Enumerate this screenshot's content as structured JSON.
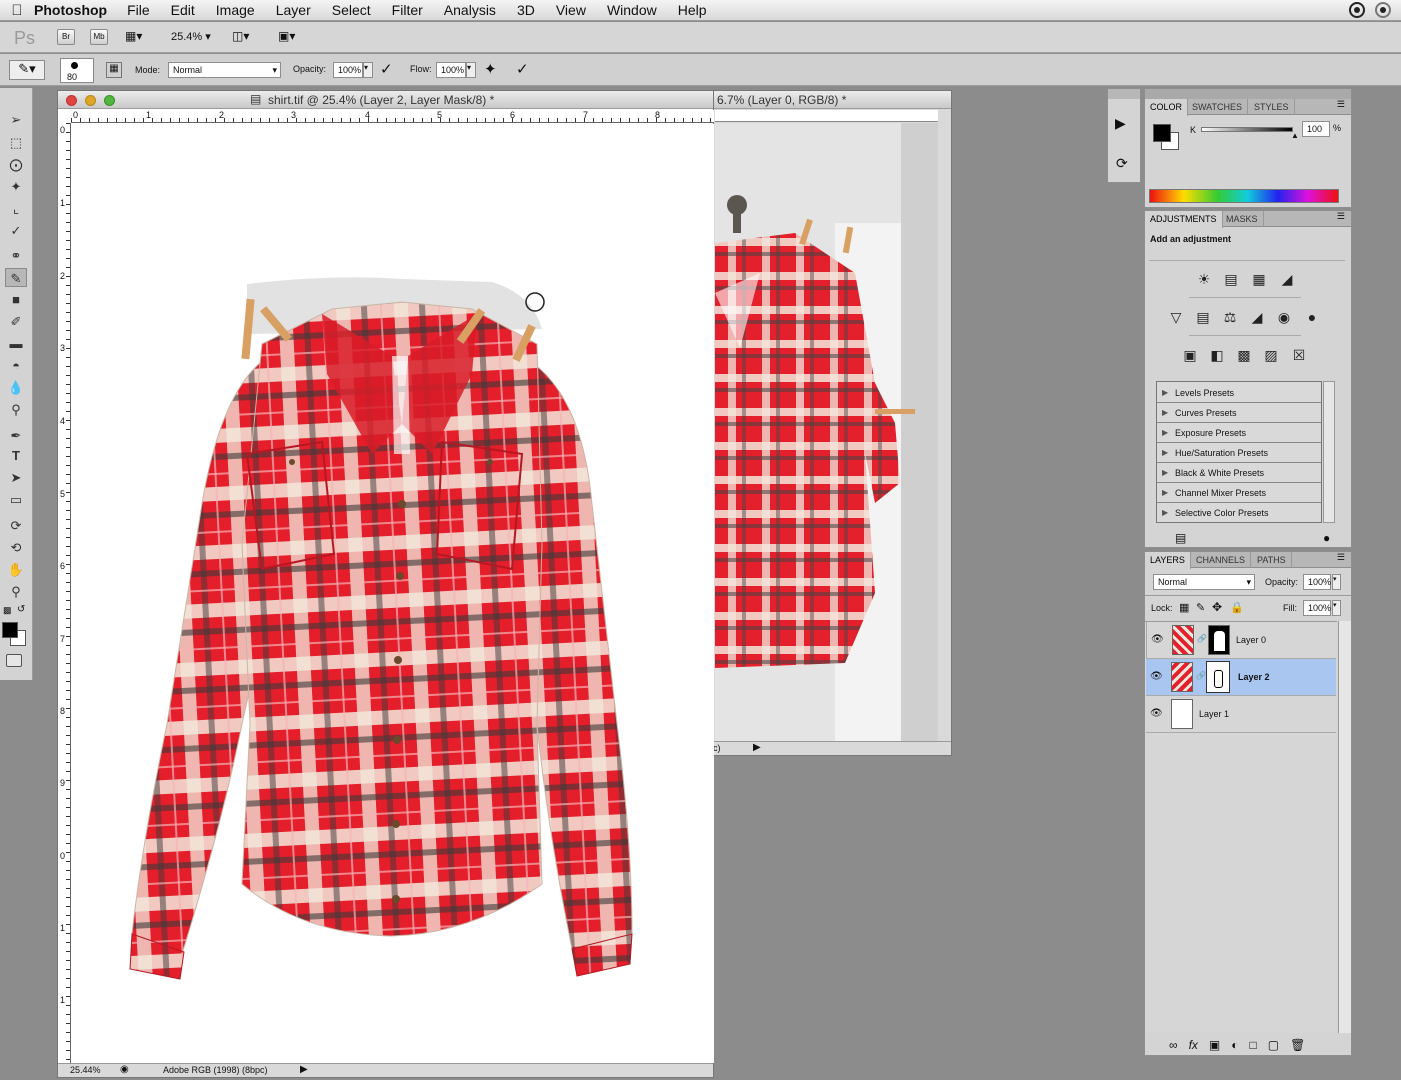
{
  "menubar": {
    "app_name": "Photoshop",
    "items": [
      "File",
      "Edit",
      "Image",
      "Layer",
      "Select",
      "Filter",
      "Analysis",
      "3D",
      "View",
      "Window",
      "Help"
    ]
  },
  "appbar": {
    "logo": "Ps",
    "bridge_label": "Br",
    "minibridge_label": "Mb",
    "zoom": "25.4%"
  },
  "options": {
    "brush_size": "80",
    "mode_label": "Mode:",
    "mode_value": "Normal",
    "opacity_label": "Opacity:",
    "opacity_value": "100%",
    "flow_label": "Flow:",
    "flow_value": "100%"
  },
  "doc_main": {
    "title": "shirt.tif @ 25.4% (Layer 2, Layer Mask/8) *",
    "ruler_h": [
      "0",
      "1",
      "2",
      "3",
      "4",
      "5",
      "6",
      "7",
      "8"
    ],
    "ruler_v": [
      "0",
      "1",
      "2",
      "3",
      "4",
      "5",
      "6",
      "7",
      "8",
      "9",
      "0",
      "1",
      "1"
    ],
    "status_zoom": "25.44%",
    "status_profile": "Adobe RGB (1998) (8bpc)"
  },
  "doc_second": {
    "title": "6.7% (Layer 0, RGB/8) *",
    "status_fragment": "c)"
  },
  "color_panel": {
    "tabs": [
      "COLOR",
      "SWATCHES",
      "STYLES"
    ],
    "channel_label": "K",
    "channel_value": "100",
    "unit": "%"
  },
  "adjustments_panel": {
    "tabs": [
      "ADJUSTMENTS",
      "MASKS"
    ],
    "heading": "Add an adjustment",
    "presets": [
      "Levels Presets",
      "Curves Presets",
      "Exposure Presets",
      "Hue/Saturation Presets",
      "Black & White Presets",
      "Channel Mixer Presets",
      "Selective Color Presets"
    ]
  },
  "layers_panel": {
    "tabs": [
      "LAYERS",
      "CHANNELS",
      "PATHS"
    ],
    "blend_mode": "Normal",
    "opacity_label": "Opacity:",
    "opacity_value": "100%",
    "lock_label": "Lock:",
    "fill_label": "Fill:",
    "fill_value": "100%",
    "layers": [
      {
        "name": "Layer 0",
        "selected": false
      },
      {
        "name": "Layer 2",
        "selected": true
      },
      {
        "name": "Layer 1",
        "selected": false
      }
    ]
  },
  "colors": {
    "menubar_bg": "#e6e6e6",
    "workspace_bg": "#8c8c8c",
    "selection": "#a9c6f0",
    "shirt_red": "#e3202b"
  }
}
